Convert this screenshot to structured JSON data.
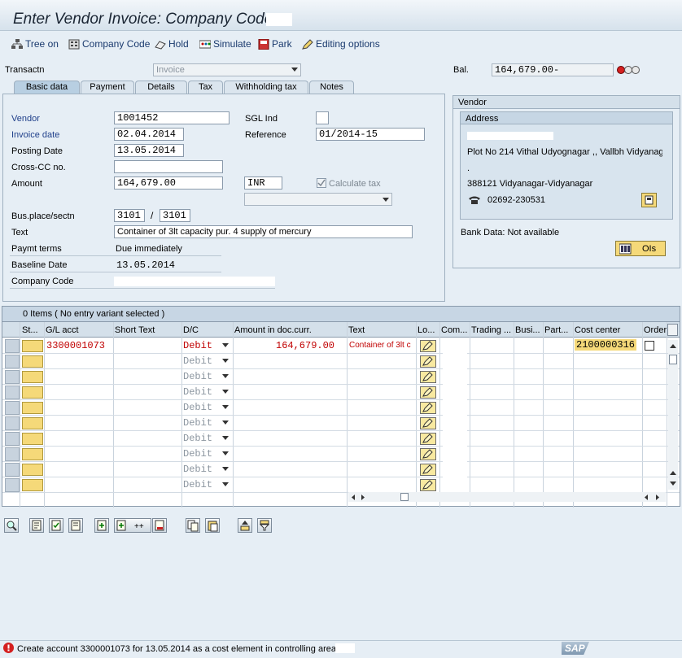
{
  "title": "Enter Vendor Invoice: Company Code",
  "toolbar": {
    "tree_on": "Tree on",
    "company_code": "Company Code",
    "hold": "Hold",
    "simulate": "Simulate",
    "park": "Park",
    "editing_options": "Editing options"
  },
  "header": {
    "transactn_label": "Transactn",
    "transactn_value": "Invoice",
    "bal_label": "Bal.",
    "bal_value": "164,679.00-"
  },
  "tabs": [
    "Basic data",
    "Payment",
    "Details",
    "Tax",
    "Withholding tax",
    "Notes"
  ],
  "basic": {
    "vendor_label": "Vendor",
    "vendor_value": "1001452",
    "sgl_label": "SGL Ind",
    "invoice_date_label": "Invoice date",
    "invoice_date_value": "02.04.2014",
    "reference_label": "Reference",
    "reference_value": "01/2014-15",
    "posting_date_label": "Posting Date",
    "posting_date_value": "13.05.2014",
    "cross_cc_label": "Cross-CC no.",
    "amount_label": "Amount",
    "amount_value": "164,679.00",
    "currency": "INR",
    "calc_tax_label": "Calculate tax",
    "bus_place_label": "Bus.place/sectn",
    "bus_place_1": "3101",
    "bus_place_sep": "/",
    "bus_place_2": "3101",
    "text_label": "Text",
    "text_value": "Container of 3lt capacity pur. 4 supply of mercury",
    "paymt_terms_label": "Paymt terms",
    "paymt_terms_value": "Due immediately",
    "baseline_label": "Baseline Date",
    "baseline_value": "13.05.2014",
    "company_code_label": "Company Code"
  },
  "vendor_panel": {
    "title": "Vendor",
    "address_title": "Address",
    "line2": "Plot No 214 Vithal Udyognagar ,, Vallbh Vidyanag",
    "line3": ".",
    "line4": "388121 Vidyanagar-Vidyanagar",
    "phone": "02692-230531",
    "bank": "Bank Data: Not available",
    "ois_label": "OIs"
  },
  "grid": {
    "summary": "0 Items ( No entry variant selected )",
    "columns": [
      "St...",
      "G/L acct",
      "Short Text",
      "D/C",
      "Amount in doc.curr.",
      "Text",
      "Lo...",
      "Com...",
      "Trading ...",
      "Busi...",
      "Part...",
      "Cost center",
      "Order"
    ],
    "row1": {
      "gl": "3300001073",
      "dc": "Debit",
      "amount": "164,679.00",
      "text": "Container of 3lt c",
      "cost_center": "2100000316"
    },
    "empty_dc": "Debit"
  },
  "status": {
    "message": "Create account 3300001073 for 13.05.2014 as a cost element in controlling area",
    "logo": "SAP"
  }
}
